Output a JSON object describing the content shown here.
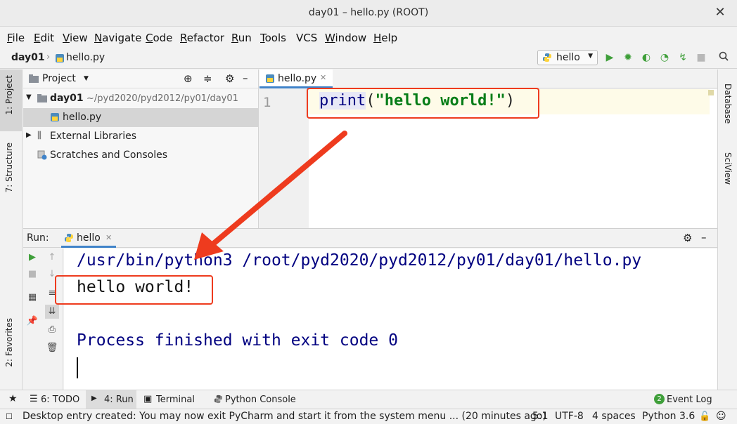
{
  "window": {
    "title": "day01 – hello.py (ROOT)"
  },
  "menu": [
    "File",
    "Edit",
    "View",
    "Navigate",
    "Code",
    "Refactor",
    "Run",
    "Tools",
    "VCS",
    "Window",
    "Help"
  ],
  "menu_mnemonic": [
    "F",
    "E",
    "V",
    "N",
    "C",
    "R",
    "R",
    "T",
    "",
    "W",
    "H"
  ],
  "breadcrumb": {
    "project": "day01",
    "file": "hello.py"
  },
  "run_config": {
    "label": "hello"
  },
  "left_stripe": {
    "project_tab": "1: Project",
    "structure_tab": "7: Structure",
    "favorites_tab": "2: Favorites"
  },
  "right_stripe": {
    "database_tab": "Database",
    "sciview_tab": "SciView"
  },
  "project_panel": {
    "title": "Project",
    "root_name": "day01",
    "root_path": "~/pyd2020/pyd2012/py01/day01",
    "file": "hello.py",
    "ext_libs": "External Libraries",
    "scratches": "Scratches and Consoles"
  },
  "editor": {
    "tab_label": "hello.py",
    "line_number": "1",
    "code_func": "print",
    "code_open": "(",
    "code_string": "\"hello world!\"",
    "code_close": ")"
  },
  "run_panel": {
    "label": "Run:",
    "tab_label": "hello",
    "console": {
      "command": "/usr/bin/python3 /root/pyd2020/pyd2012/py01/day01/hello.py",
      "output": "hello world!",
      "exit": "Process finished with exit code 0"
    }
  },
  "bottom_tabs": {
    "todo": "6: TODO",
    "run": "4: Run",
    "terminal": "Terminal",
    "python_console": "Python Console",
    "event_log": "Event Log",
    "event_count": "2"
  },
  "status": {
    "message": "Desktop entry created: You may now exit PyCharm and start it from the system menu ... (20 minutes ago)",
    "position": "5:1",
    "encoding": "UTF-8",
    "indent": "4 spaces",
    "interpreter": "Python 3.6"
  },
  "colors": {
    "annotation": "#ee3b1e",
    "console_text": "#000080",
    "string": "#067d17",
    "selection_tab": "#4083c9"
  }
}
